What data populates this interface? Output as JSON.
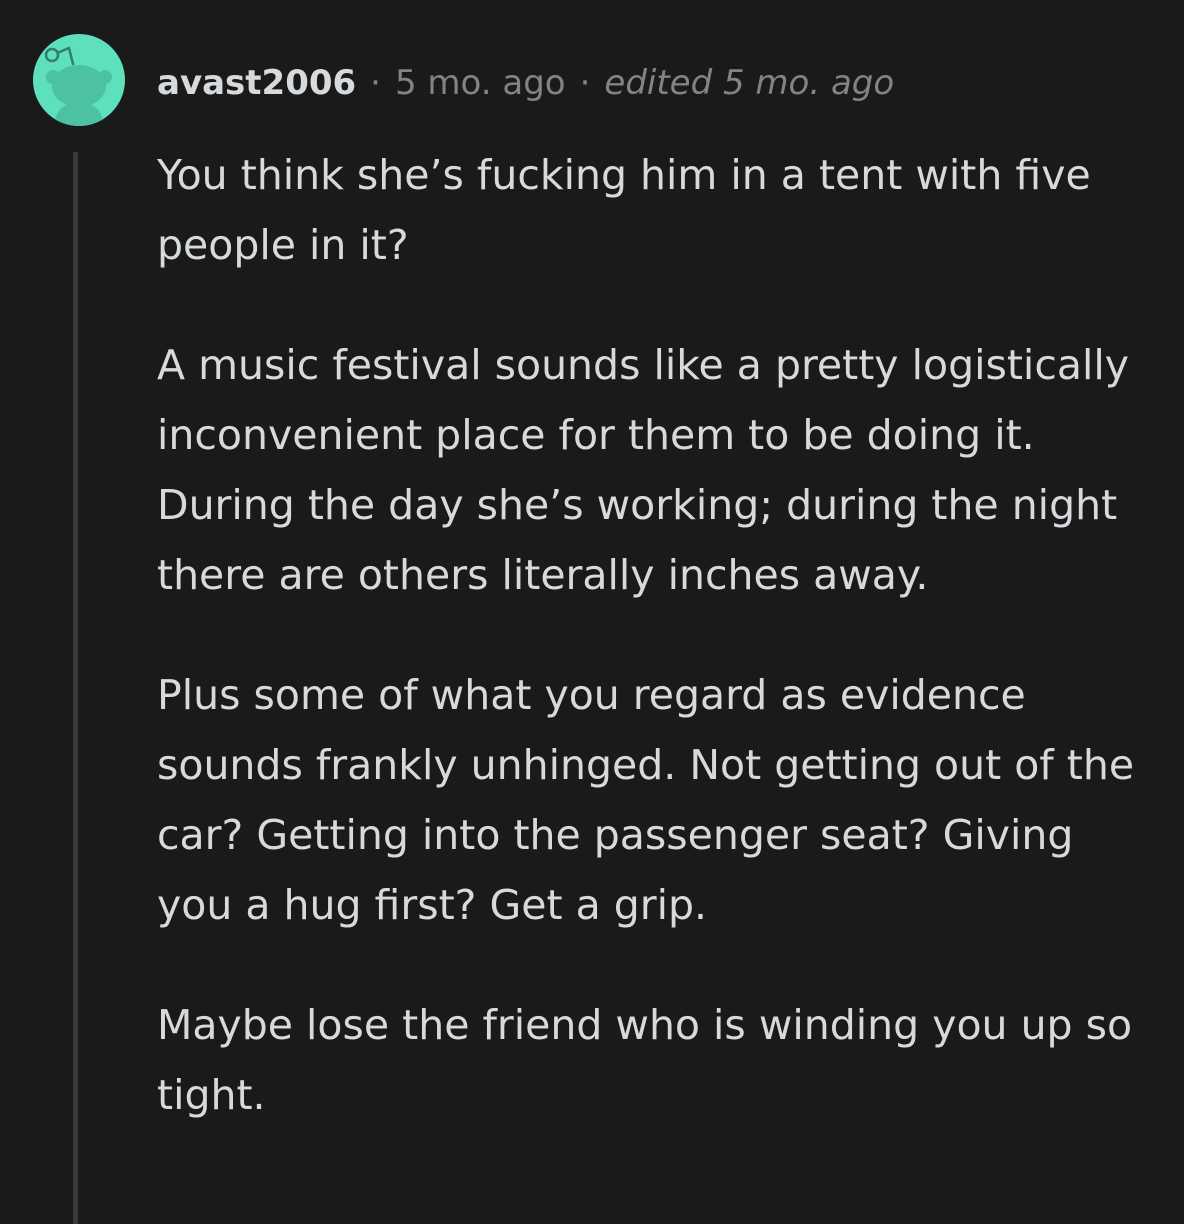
{
  "comment": {
    "username": "avast2006",
    "separator": "·",
    "timestamp": "5 mo. ago",
    "edited": "edited 5 mo. ago",
    "avatar_icon": "snoo-avatar-icon",
    "avatar_color": "#5fe0bd",
    "paragraphs": [
      "You think she’s fucking him in a tent with five people in it?",
      "A music festival sounds like a pretty logistically inconvenient place for them to be doing it. During the day she’s working; during the night there are others literally inches away.",
      "Plus some of what you regard as evidence sounds frankly unhinged. Not getting out of the car? Getting into the passenger seat? Giving you a hug first? Get a grip.",
      "Maybe lose the friend who is winding you up so tight."
    ]
  }
}
